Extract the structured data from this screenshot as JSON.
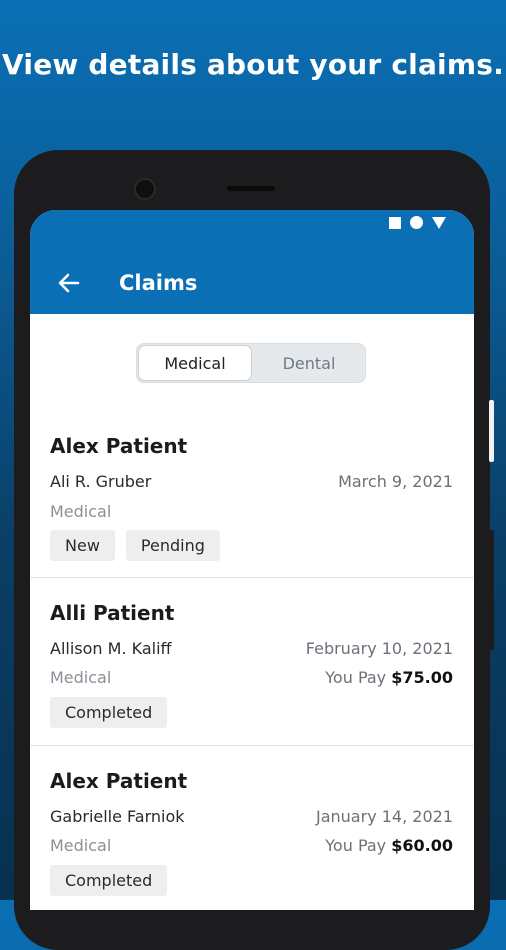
{
  "headline": "View details about your claims.",
  "appbar": {
    "title": "Claims",
    "back_icon": "arrow-left-icon"
  },
  "status_icons": [
    "square-icon",
    "circle-icon",
    "triangle-icon"
  ],
  "tabs": {
    "medical": "Medical",
    "dental": "Dental",
    "selected": "Medical"
  },
  "claims": [
    {
      "patient": "Alex Patient",
      "provider": "Ali R. Gruber",
      "date": "March 9, 2021",
      "type": "Medical",
      "pay_label": "",
      "pay_amount": "",
      "chips": [
        "New",
        "Pending"
      ]
    },
    {
      "patient": "Alli Patient",
      "provider": "Allison M. Kaliff",
      "date": "February 10, 2021",
      "type": "Medical",
      "pay_label": "You Pay",
      "pay_amount": "$75.00",
      "chips": [
        "Completed"
      ]
    },
    {
      "patient": "Alex Patient",
      "provider": "Gabrielle Farniok",
      "date": "January 14, 2021",
      "type": "Medical",
      "pay_label": "You Pay",
      "pay_amount": "$60.00",
      "chips": [
        "Completed"
      ]
    }
  ],
  "colors": {
    "brand": "#0a6fb4",
    "chip_bg": "#eceef0"
  }
}
